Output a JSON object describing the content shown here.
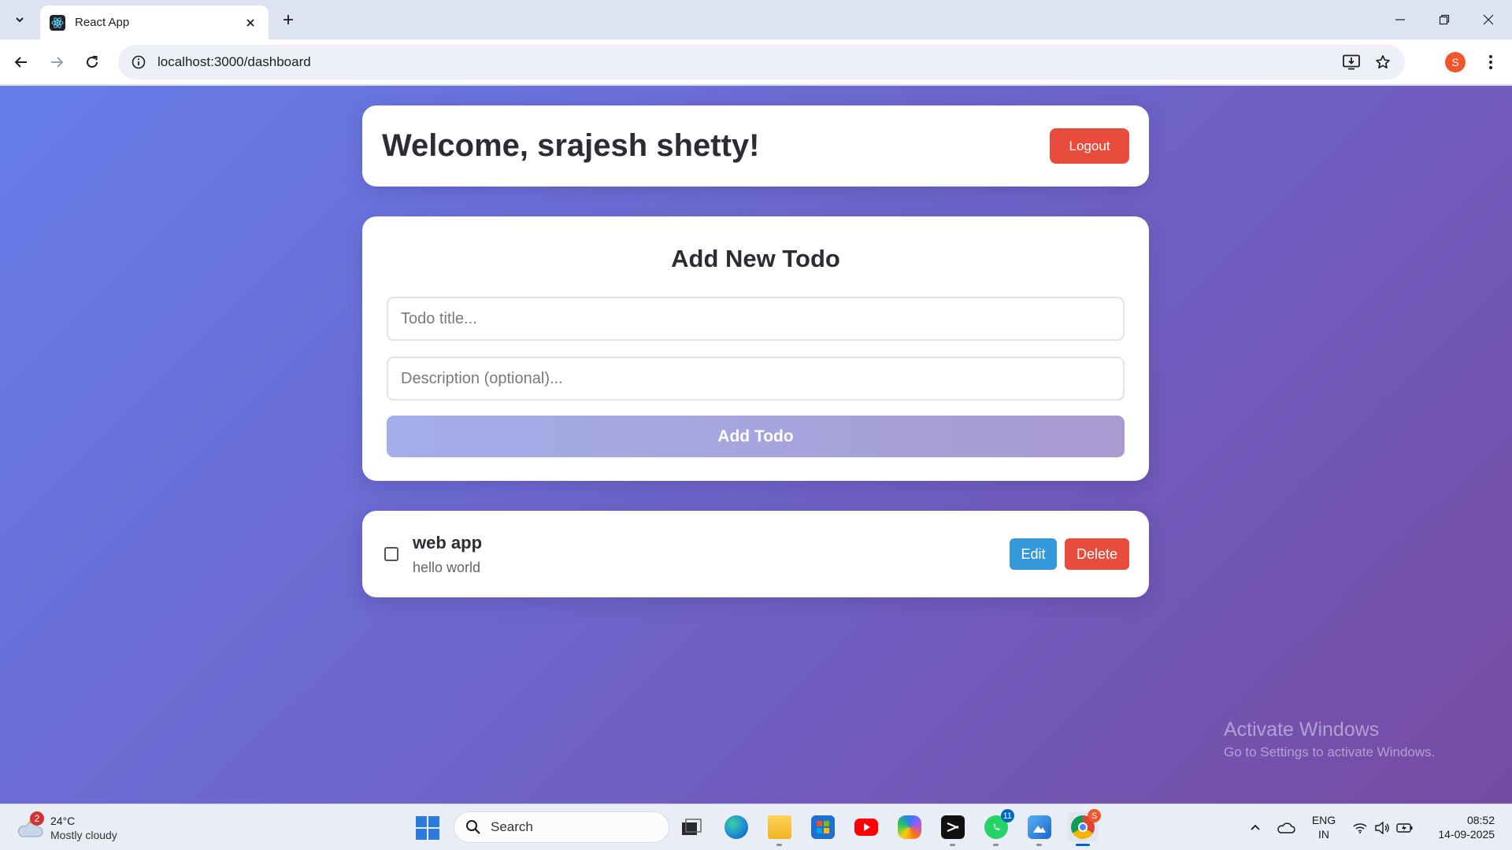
{
  "browser": {
    "tab_title": "React App",
    "url": "localhost:3000/dashboard",
    "profile_initial": "S"
  },
  "header": {
    "welcome": "Welcome, srajesh shetty!",
    "logout_label": "Logout"
  },
  "add_todo": {
    "heading": "Add New Todo",
    "title_placeholder": "Todo title...",
    "description_placeholder": "Description (optional)...",
    "title_value": "",
    "description_value": "",
    "submit_label": "Add Todo"
  },
  "todos": [
    {
      "title": "web app",
      "description": "hello world",
      "completed": false,
      "edit_label": "Edit",
      "delete_label": "Delete"
    }
  ],
  "watermark": {
    "title": "Activate Windows",
    "subtitle": "Go to Settings to activate Windows."
  },
  "taskbar": {
    "weather": {
      "badge": "2",
      "temperature": "24°C",
      "condition": "Mostly cloudy"
    },
    "search_label": "Search",
    "apps": [
      {
        "name": "task-view"
      },
      {
        "name": "edge"
      },
      {
        "name": "file-explorer"
      },
      {
        "name": "microsoft-store"
      },
      {
        "name": "youtube"
      },
      {
        "name": "copilot"
      },
      {
        "name": "capcut"
      },
      {
        "name": "whatsapp",
        "badge": "11"
      },
      {
        "name": "photos"
      },
      {
        "name": "chrome",
        "badge": "S"
      }
    ],
    "language": {
      "line1": "ENG",
      "line2": "IN"
    },
    "time": "08:52",
    "date": "14-09-2025"
  },
  "colors": {
    "gradient_start": "#667eea",
    "gradient_end": "#764ba2",
    "danger": "#e74c3c",
    "primary": "#3498db"
  }
}
